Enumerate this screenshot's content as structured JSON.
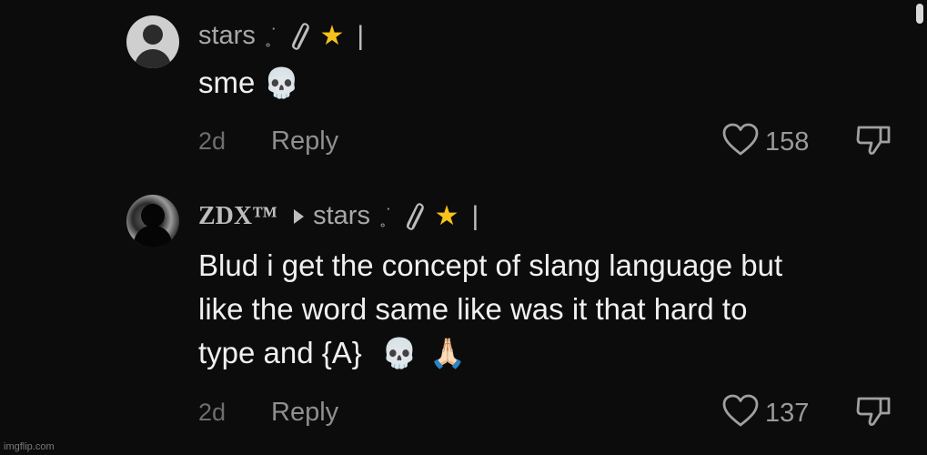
{
  "comments": [
    {
      "username": "stars",
      "username_decor": "˳˙",
      "badge_icon": "star-icon",
      "text_lines": [
        "sme"
      ],
      "text_emoji": [
        "💀"
      ],
      "time": "2d",
      "reply_label": "Reply",
      "likes": "158"
    },
    {
      "username": "ZDX™",
      "reply_to": "stars",
      "reply_to_decor": "˳˙",
      "badge_icon": "star-icon",
      "text_lines": [
        "Blud i get the concept of slang language but",
        "like the word same like was it that hard to",
        "type and {A}"
      ],
      "text_emoji": [
        "💀",
        "🙏🏻"
      ],
      "time": "2d",
      "reply_label": "Reply",
      "likes": "137"
    }
  ],
  "watermark": "imgflip.com",
  "colors": {
    "background": "#0c0c0c",
    "username": "#a8a8a8",
    "text": "#f0f0f0",
    "meta": "#8f8f8f",
    "star": "#f7c21a"
  }
}
